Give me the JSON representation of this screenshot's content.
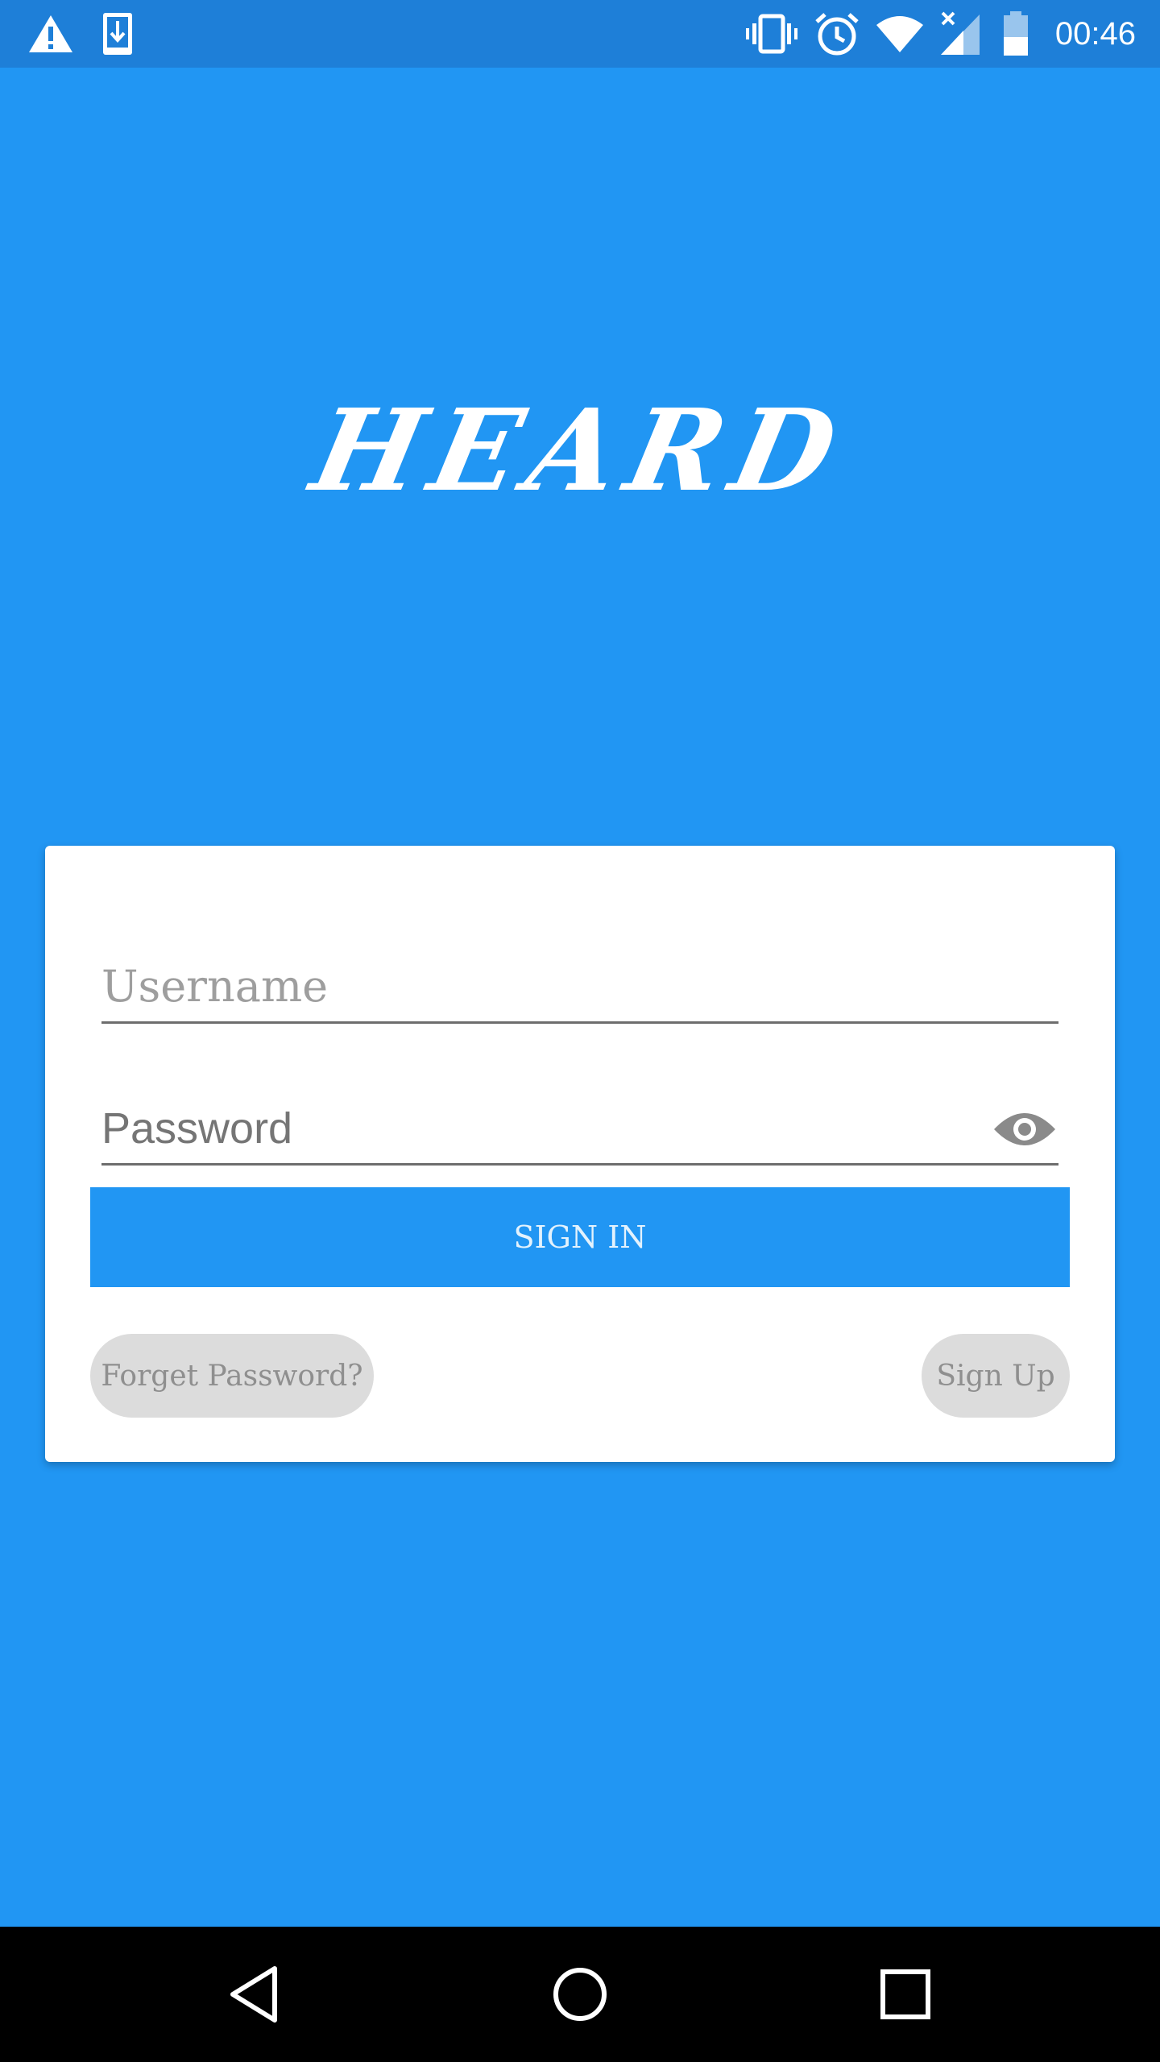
{
  "status_bar": {
    "time": "00:46",
    "left_icons": [
      "warning-icon",
      "download-icon"
    ],
    "right_icons": [
      "vibrate-icon",
      "alarm-icon",
      "wifi-icon",
      "signal-icon",
      "battery-icon"
    ]
  },
  "logo": {
    "text": "HEARD"
  },
  "login_form": {
    "username_placeholder": "Username",
    "password_placeholder": "Password",
    "sign_in_label": "SIGN IN",
    "forget_password_label": "Forget Password?",
    "sign_up_label": "Sign Up"
  },
  "nav_bar": {
    "buttons": [
      "back-icon",
      "home-icon",
      "recents-icon"
    ]
  },
  "colors": {
    "primary": "#2196F3",
    "status_bar": "#1E7FD8",
    "card": "#FFFFFF",
    "pill": "#DCDCDC"
  }
}
